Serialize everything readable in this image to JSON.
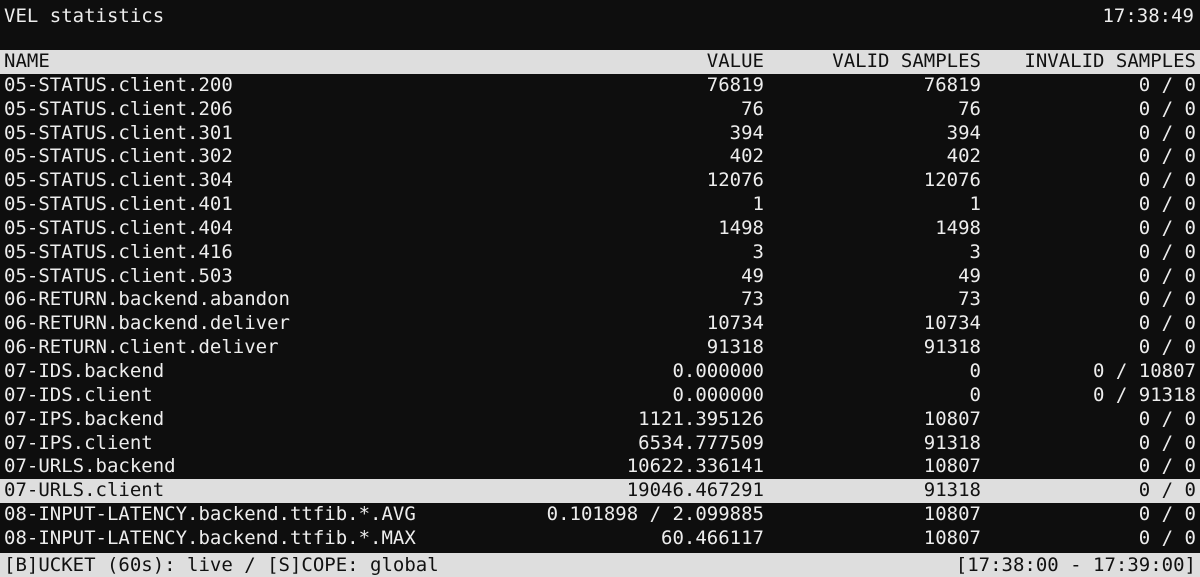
{
  "window": {
    "title": "VEL statistics",
    "clock": "17:38:49"
  },
  "table": {
    "columns": [
      "NAME",
      "VALUE",
      "VALID SAMPLES",
      "INVALID SAMPLES"
    ],
    "selected_row": "07-URLS.client",
    "rows": [
      {
        "name": "05-STATUS.client.200",
        "value": "76819",
        "valid": "76819",
        "invalid": "0 / 0"
      },
      {
        "name": "05-STATUS.client.206",
        "value": "76",
        "valid": "76",
        "invalid": "0 / 0"
      },
      {
        "name": "05-STATUS.client.301",
        "value": "394",
        "valid": "394",
        "invalid": "0 / 0"
      },
      {
        "name": "05-STATUS.client.302",
        "value": "402",
        "valid": "402",
        "invalid": "0 / 0"
      },
      {
        "name": "05-STATUS.client.304",
        "value": "12076",
        "valid": "12076",
        "invalid": "0 / 0"
      },
      {
        "name": "05-STATUS.client.401",
        "value": "1",
        "valid": "1",
        "invalid": "0 / 0"
      },
      {
        "name": "05-STATUS.client.404",
        "value": "1498",
        "valid": "1498",
        "invalid": "0 / 0"
      },
      {
        "name": "05-STATUS.client.416",
        "value": "3",
        "valid": "3",
        "invalid": "0 / 0"
      },
      {
        "name": "05-STATUS.client.503",
        "value": "49",
        "valid": "49",
        "invalid": "0 / 0"
      },
      {
        "name": "06-RETURN.backend.abandon",
        "value": "73",
        "valid": "73",
        "invalid": "0 / 0"
      },
      {
        "name": "06-RETURN.backend.deliver",
        "value": "10734",
        "valid": "10734",
        "invalid": "0 / 0"
      },
      {
        "name": "06-RETURN.client.deliver",
        "value": "91318",
        "valid": "91318",
        "invalid": "0 / 0"
      },
      {
        "name": "07-IDS.backend",
        "value": "0.000000",
        "valid": "0",
        "invalid": "0 / 10807"
      },
      {
        "name": "07-IDS.client",
        "value": "0.000000",
        "valid": "0",
        "invalid": "0 / 91318"
      },
      {
        "name": "07-IPS.backend",
        "value": "1121.395126",
        "valid": "10807",
        "invalid": "0 / 0"
      },
      {
        "name": "07-IPS.client",
        "value": "6534.777509",
        "valid": "91318",
        "invalid": "0 / 0"
      },
      {
        "name": "07-URLS.backend",
        "value": "10622.336141",
        "valid": "10807",
        "invalid": "0 / 0"
      },
      {
        "name": "07-URLS.client",
        "value": "19046.467291",
        "valid": "91318",
        "invalid": "0 / 0"
      },
      {
        "name": "08-INPUT-LATENCY.backend.ttfib.*.AVG",
        "value": "0.101898 / 2.099885",
        "valid": "10807",
        "invalid": "0 / 0"
      },
      {
        "name": "08-INPUT-LATENCY.backend.ttfib.*.MAX",
        "value": "60.466117",
        "valid": "10807",
        "invalid": "0 / 0"
      }
    ]
  },
  "status_bar": {
    "left": "[B]UCKET (60s): live / [S]COPE: global",
    "right": "[17:38:00 - 17:39:00]"
  },
  "colors": {
    "background": "#0e0e0e",
    "text": "#ededed",
    "highlight": "#dedede",
    "highlight_text": "#111111"
  }
}
